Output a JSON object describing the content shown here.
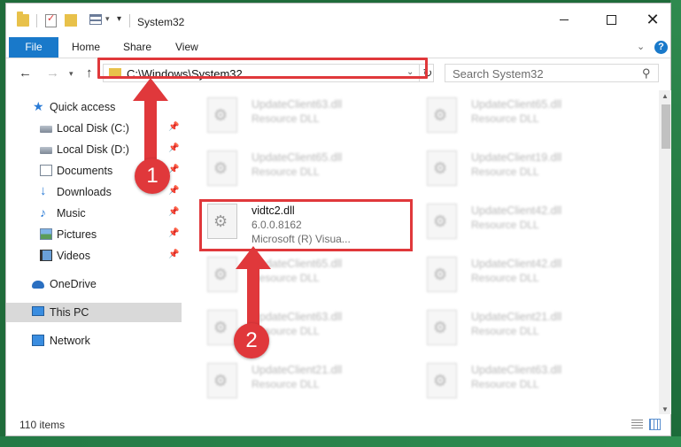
{
  "window": {
    "title": "System32",
    "controls": {
      "minimize": "—",
      "maximize": "☐",
      "close": "✕"
    }
  },
  "ribbon": {
    "tabs": [
      {
        "label": "File"
      },
      {
        "label": "Home"
      },
      {
        "label": "Share"
      },
      {
        "label": "View"
      }
    ],
    "help": "?"
  },
  "address": {
    "path": "C:\\Windows\\System32",
    "search_placeholder": "Search System32"
  },
  "sidebar": {
    "items": [
      {
        "label": "Quick access",
        "icon": "quick-access-star-icon"
      },
      {
        "label": "Local Disk (C:)",
        "icon": "disk-icon",
        "pinned": true
      },
      {
        "label": "Local Disk (D:)",
        "icon": "disk-icon",
        "pinned": true
      },
      {
        "label": "Documents",
        "icon": "documents-icon",
        "pinned": true
      },
      {
        "label": "Downloads",
        "icon": "downloads-icon",
        "pinned": true
      },
      {
        "label": "Music",
        "icon": "music-icon",
        "pinned": true
      },
      {
        "label": "Pictures",
        "icon": "pictures-icon",
        "pinned": true
      },
      {
        "label": "Videos",
        "icon": "videos-icon",
        "pinned": true
      },
      {
        "label": "OneDrive",
        "icon": "onedrive-icon"
      },
      {
        "label": "This PC",
        "icon": "this-pc-icon",
        "selected": true
      },
      {
        "label": "Network",
        "icon": "network-icon"
      }
    ]
  },
  "files": {
    "left": [
      {
        "name": "UpdateClient63.dll",
        "type": "Resource DLL"
      },
      {
        "name": "UpdateClient65.dll",
        "type": "Resource DLL"
      },
      {
        "name": "vidtc2.dll",
        "version": "6.0.0.8162",
        "company": "Microsoft (R) Visua..."
      },
      {
        "name": "UpdateClient65.dll",
        "type": "Resource DLL"
      },
      {
        "name": "UpdateClient63.dll",
        "type": "Resource DLL"
      },
      {
        "name": "UpdateClient21.dll",
        "type": "Resource DLL"
      }
    ],
    "right": [
      {
        "name": "UpdateClient65.dll",
        "type": "Resource DLL"
      },
      {
        "name": "UpdateClient19.dll",
        "type": "Resource DLL"
      },
      {
        "name": "UpdateClient42.dll",
        "type": "Resource DLL"
      },
      {
        "name": "UpdateClient42.dll",
        "type": "Resource DLL"
      },
      {
        "name": "UpdateClient21.dll",
        "type": "Resource DLL"
      },
      {
        "name": "UpdateClient63.dll",
        "type": "Resource DLL"
      }
    ]
  },
  "status": {
    "count": "110 items"
  },
  "annotations": {
    "step1": "1",
    "step2": "2",
    "color": "#e0383b"
  }
}
